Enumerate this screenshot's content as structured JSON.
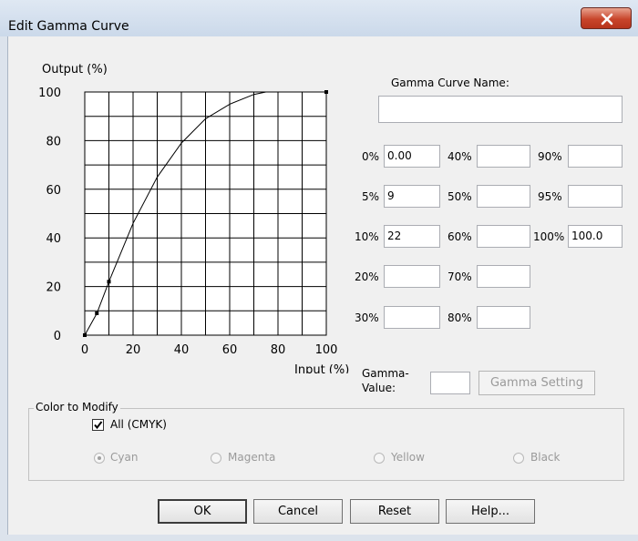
{
  "window": {
    "title": "Edit Gamma Curve"
  },
  "chart_data": {
    "type": "line",
    "ylabel": "Output (%)",
    "xlabel": "Input (%)",
    "xlim": [
      0,
      100
    ],
    "ylim": [
      0,
      100
    ],
    "x_ticks": [
      "0",
      "20",
      "40",
      "60",
      "80",
      "100"
    ],
    "y_ticks": [
      "100",
      "80",
      "60",
      "40",
      "20",
      "0"
    ],
    "grid": true,
    "series": [
      {
        "x": [
          0,
          5,
          10,
          20,
          30,
          40,
          50,
          60,
          70,
          75,
          80,
          100
        ],
        "y": [
          0,
          9,
          22,
          46,
          65,
          79,
          89,
          95,
          99,
          100,
          100,
          100
        ]
      }
    ],
    "markers": {
      "x": [
        0,
        5,
        10,
        100
      ],
      "y": [
        0,
        9,
        22,
        100
      ]
    }
  },
  "gamma_name": {
    "label": "Gamma Curve Name:",
    "value": ""
  },
  "points": [
    {
      "label": "0%",
      "value": "0.00"
    },
    {
      "label": "40%",
      "value": ""
    },
    {
      "label": "90%",
      "value": ""
    },
    {
      "label": "5%",
      "value": "9"
    },
    {
      "label": "50%",
      "value": ""
    },
    {
      "label": "95%",
      "value": ""
    },
    {
      "label": "10%",
      "value": "22"
    },
    {
      "label": "60%",
      "value": ""
    },
    {
      "label": "100%",
      "value": "100.0"
    },
    {
      "label": "20%",
      "value": ""
    },
    {
      "label": "70%",
      "value": ""
    },
    {
      "label": "30%",
      "value": ""
    },
    {
      "label": "80%",
      "value": ""
    }
  ],
  "gamma_value": {
    "label_line1": "Gamma-",
    "label_line2": "Value:",
    "value": ""
  },
  "gamma_setting_button": "Gamma Setting",
  "color_group": {
    "legend": "Color to Modify",
    "all_label": "All (CMYK)",
    "all_checked": true,
    "options": [
      "Cyan",
      "Magenta",
      "Yellow",
      "Black"
    ],
    "selected": "Cyan"
  },
  "buttons": {
    "ok": "OK",
    "cancel": "Cancel",
    "reset": "Reset",
    "help": "Help..."
  }
}
